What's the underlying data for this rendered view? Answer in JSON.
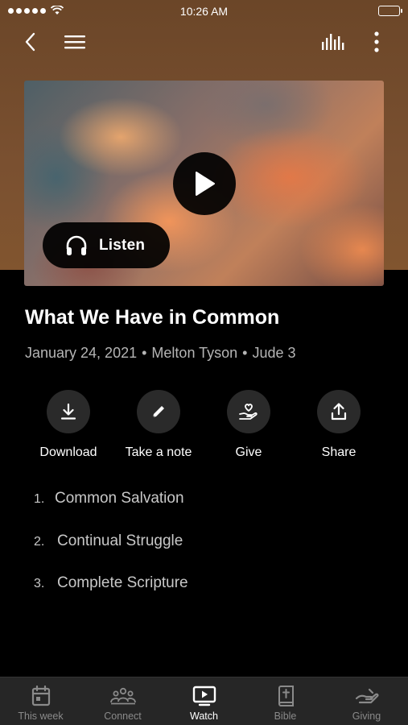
{
  "status_bar": {
    "time": "10:26 AM"
  },
  "nav": {
    "back": "back-icon",
    "menu": "menu-icon",
    "audio": "audio-bars-icon",
    "more": "more-vertical-icon"
  },
  "video": {
    "listen_label": "Listen"
  },
  "sermon": {
    "title": "What We Have in Common",
    "date": "January 24, 2021",
    "sep": "•",
    "speaker": "Melton Tyson",
    "passage": "Jude 3"
  },
  "actions": [
    {
      "label": "Download",
      "icon": "download-icon"
    },
    {
      "label": "Take a note",
      "icon": "pencil-icon"
    },
    {
      "label": "Give",
      "icon": "give-hand-heart-icon"
    },
    {
      "label": "Share",
      "icon": "share-icon"
    }
  ],
  "outline": [
    {
      "num": "1.",
      "text": "Common Salvation"
    },
    {
      "num": "2.",
      "text": "Continual Struggle"
    },
    {
      "num": "3.",
      "text": "Complete Scripture"
    }
  ],
  "tabs": [
    {
      "label": "This week",
      "icon": "calendar-icon",
      "active": false
    },
    {
      "label": "Connect",
      "icon": "people-icon",
      "active": false
    },
    {
      "label": "Watch",
      "icon": "tv-play-icon",
      "active": true
    },
    {
      "label": "Bible",
      "icon": "bible-icon",
      "active": false
    },
    {
      "label": "Giving",
      "icon": "giving-hand-icon",
      "active": false
    }
  ],
  "colors": {
    "header_brown": "#7a5030",
    "background": "#000000",
    "tabbar": "#262626",
    "action_circle": "#2a2a2a",
    "muted_text": "#b5b5b5"
  }
}
